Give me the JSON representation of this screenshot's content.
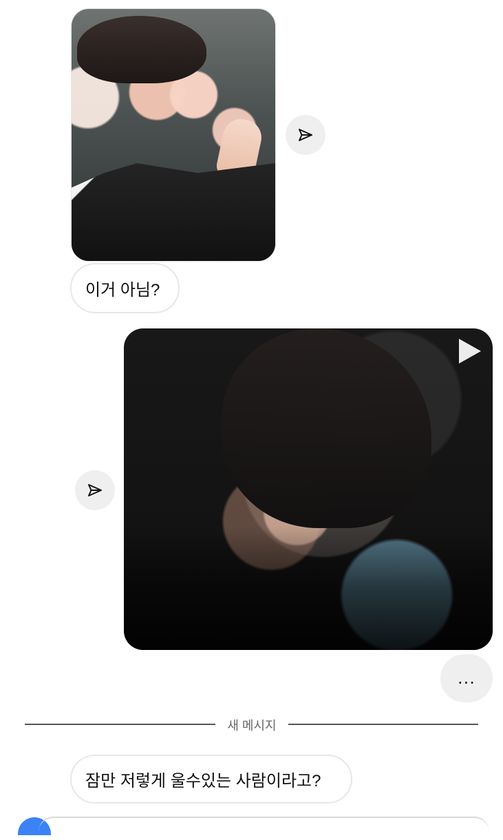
{
  "messages": {
    "first_text": "이거 아님?",
    "new_message_label": "새 메시지",
    "second_text": "잠만 저렇게 울수있는 사람이라고?"
  },
  "controls": {
    "more_label": "...",
    "share_icon": "paper-plane-icon",
    "play_icon": "play-icon"
  },
  "colors": {
    "bubble_border": "#e7e7e7",
    "round_button": "#efefef",
    "divider": "#555555",
    "composer_accent": "#3b82f6"
  }
}
